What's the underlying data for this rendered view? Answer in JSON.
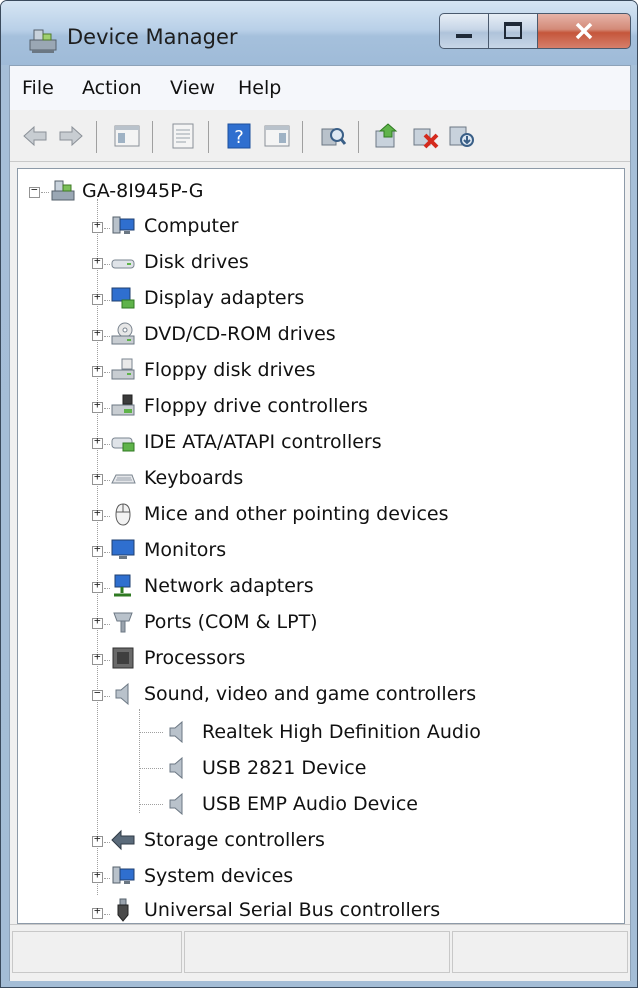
{
  "window": {
    "title": "Device Manager"
  },
  "menu": [
    "File",
    "Action",
    "View",
    "Help"
  ],
  "toolbar": [
    "back-icon",
    "forward-icon",
    "show-hide-tree-icon",
    "properties-icon",
    "help-icon",
    "action-pane-icon",
    "scan-hardware-icon",
    "update-driver-icon",
    "disable-device-icon",
    "uninstall-device-icon"
  ],
  "tree": {
    "root": "GA-8I945P-G",
    "categories": [
      {
        "label": "Computer",
        "icon": "computer-icon"
      },
      {
        "label": "Disk drives",
        "icon": "disk-drive-icon"
      },
      {
        "label": "Display adapters",
        "icon": "display-adapter-icon"
      },
      {
        "label": "DVD/CD-ROM drives",
        "icon": "dvd-drive-icon"
      },
      {
        "label": "Floppy disk drives",
        "icon": "floppy-drive-icon"
      },
      {
        "label": "Floppy drive controllers",
        "icon": "floppy-controller-icon"
      },
      {
        "label": "IDE ATA/ATAPI controllers",
        "icon": "ide-controller-icon"
      },
      {
        "label": "Keyboards",
        "icon": "keyboard-icon"
      },
      {
        "label": "Mice and other pointing devices",
        "icon": "mouse-icon"
      },
      {
        "label": "Monitors",
        "icon": "monitor-icon"
      },
      {
        "label": "Network adapters",
        "icon": "network-adapter-icon"
      },
      {
        "label": "Ports (COM & LPT)",
        "icon": "port-icon"
      },
      {
        "label": "Processors",
        "icon": "processor-icon"
      },
      {
        "label": "Sound, video and game controllers",
        "icon": "speaker-icon"
      },
      {
        "label": "Storage controllers",
        "icon": "storage-controller-icon"
      },
      {
        "label": "System devices",
        "icon": "system-devices-icon"
      },
      {
        "label": "Universal Serial Bus controllers",
        "icon": "usb-icon"
      }
    ],
    "sound_children": [
      "Realtek High Definition Audio",
      "USB 2821 Device",
      "USB EMP Audio Device"
    ]
  },
  "status": {
    "pane1": "",
    "pane2": "",
    "pane3": ""
  }
}
